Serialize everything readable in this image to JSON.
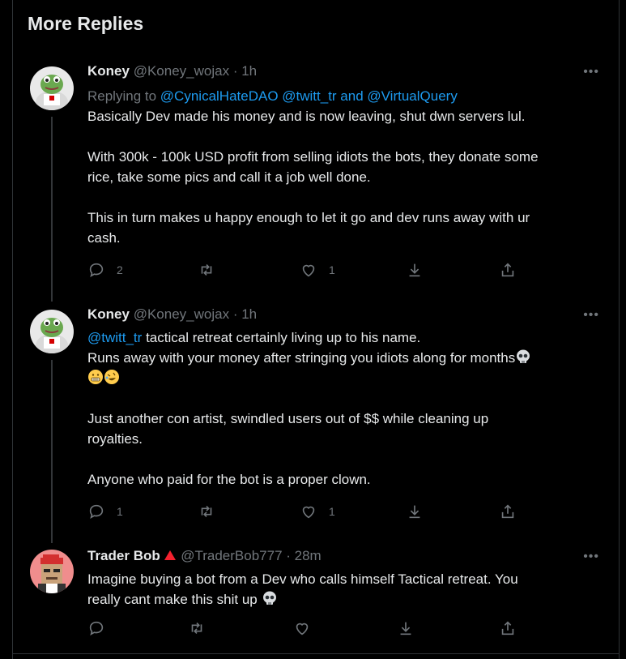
{
  "section_title": "More Replies",
  "colors": {
    "link": "#1d9bf0",
    "muted": "#71767b",
    "text": "#e7e9ea",
    "badge": "#f4212e"
  },
  "tweets": [
    {
      "name": "Koney",
      "handle": "@Koney_wojax",
      "time": "· 1h",
      "replying_prefix": "Replying to",
      "replying_to": "@CynicalHateDAO @twitt_tr and @VirtualQuery",
      "lines": [
        "Basically Dev made his money and is now leaving, shut dwn servers lul.",
        "With 300k - 100k USD profit from selling idiots the bots, they donate some",
        "rice, take some pics and call it a job well done.",
        "This in turn makes u happy enough to let it go and dev runs away with ur",
        "cash."
      ],
      "reply_count": "2",
      "retweet_count": "",
      "like_count": "1"
    },
    {
      "name": "Koney",
      "handle": "@Koney_wojax",
      "time": "· 1h",
      "mention": "@twitt_tr",
      "lines": [
        "tactical retreat certainly living up to his name.",
        "Runs away with your money after stringing you idiots along for months",
        "Just another con artist, swindled users out of $$ while cleaning up",
        "royalties.",
        "Anyone who paid for the bot is a proper clown."
      ],
      "emojis": [
        "skull-emoji",
        "grimace-emoji",
        "rofl-emoji"
      ],
      "reply_count": "1",
      "retweet_count": "",
      "like_count": "1"
    },
    {
      "name": "Trader Bob",
      "handle": "@TraderBob777",
      "time": "· 28m",
      "lines": [
        "Imagine buying a bot from a Dev who calls himself Tactical retreat. You",
        "really cant make this shit up"
      ],
      "emojis": [
        "skull-emoji"
      ],
      "reply_count": "",
      "retweet_count": "",
      "like_count": ""
    }
  ],
  "more_label": "•••"
}
